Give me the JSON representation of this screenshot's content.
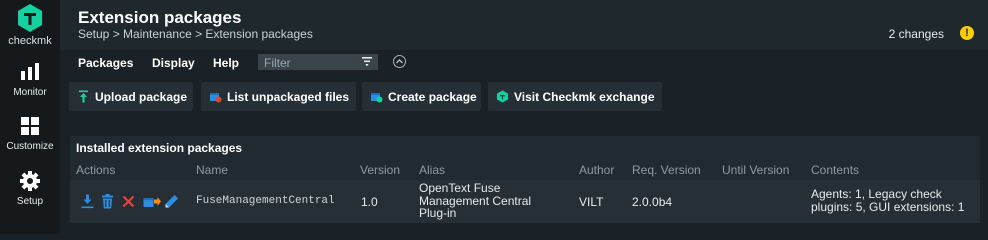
{
  "app": {
    "logo_text": "checkmk"
  },
  "sidebar": {
    "items": [
      {
        "label": "Monitor",
        "icon": "monitor-icon"
      },
      {
        "label": "Customize",
        "icon": "customize-icon"
      },
      {
        "label": "Setup",
        "icon": "setup-gear-icon"
      }
    ]
  },
  "header": {
    "title": "Extension packages",
    "breadcrumb": "Setup > Maintenance > Extension packages",
    "changes": "2 changes",
    "changes_badge": "!"
  },
  "menubar": {
    "items": [
      "Packages",
      "Display",
      "Help"
    ],
    "filter_placeholder": "Filter"
  },
  "actions": [
    {
      "label": "Upload package",
      "icon": "upload-icon"
    },
    {
      "label": "List unpackaged files",
      "icon": "unpackaged-files-icon"
    },
    {
      "label": "Create package",
      "icon": "create-package-icon"
    },
    {
      "label": "Visit Checkmk exchange",
      "icon": "checkmk-exchange-icon"
    }
  ],
  "table": {
    "title": "Installed extension packages",
    "columns": [
      "Actions",
      "Name",
      "Version",
      "Alias",
      "Author",
      "Req. Version",
      "Until Version",
      "Contents"
    ],
    "rows": [
      {
        "name": "FuseManagementCentral",
        "version": "1.0",
        "alias_lines": [
          "OpenText Fuse",
          "Management Central",
          "Plug-in"
        ],
        "author": "VILT",
        "req_version": "2.0.0b4",
        "until_version": "",
        "contents_lines": [
          "Agents: 1, Legacy check",
          "plugins: 5, GUI extensions: 1"
        ],
        "action_icons": [
          "download-icon",
          "delete-icon",
          "remove-icon",
          "release-icon",
          "edit-icon"
        ]
      }
    ]
  },
  "colors": {
    "brand": "#15d1a0",
    "warning": "#ffcc00",
    "delete_blue": "#2b8ee6",
    "remove_red": "#e8413a"
  }
}
